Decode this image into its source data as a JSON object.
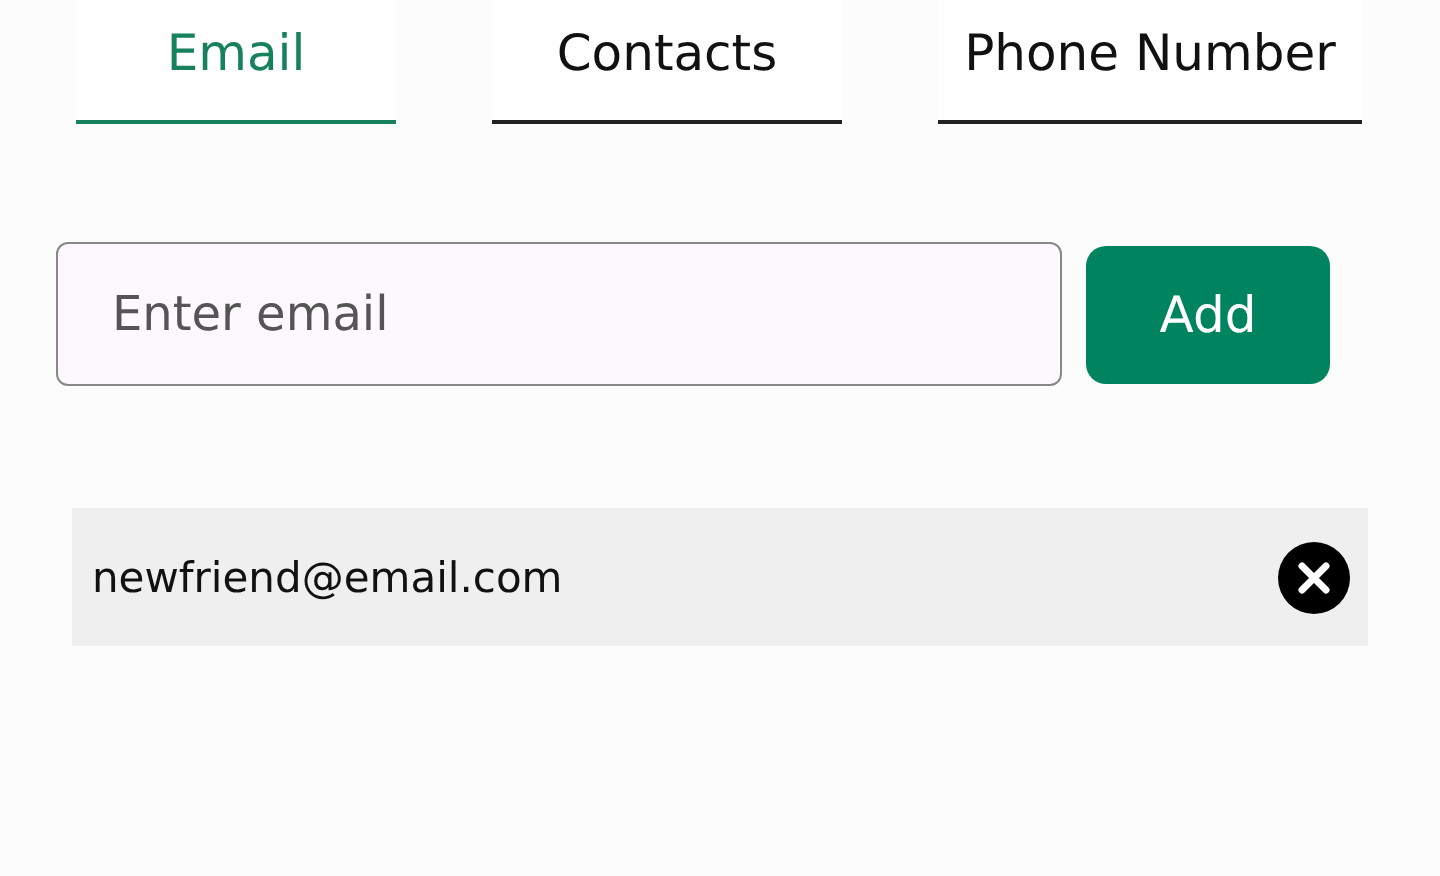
{
  "tabs": [
    {
      "label": "Email",
      "selected": true
    },
    {
      "label": "Contacts",
      "selected": false
    },
    {
      "label": "Phone Number",
      "selected": false
    }
  ],
  "email_field": {
    "placeholder": "Enter email"
  },
  "add_button": "Add",
  "emails": [
    {
      "address": "newfriend@email.com"
    }
  ]
}
